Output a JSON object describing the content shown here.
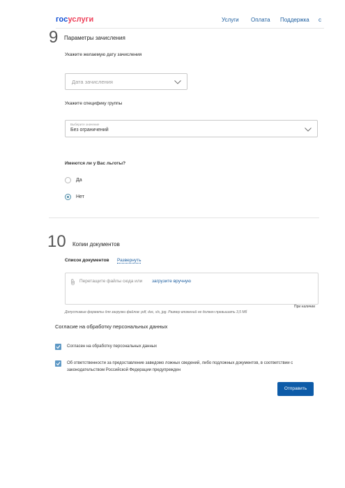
{
  "header": {
    "logo_part1": "гос",
    "logo_part2": "услуги",
    "nav": [
      "Услуги",
      "Оплата",
      "Поддержка"
    ],
    "nav_extra": "с"
  },
  "section9": {
    "number": "9",
    "title": "Параметры зачисления",
    "date_label": "Укажите желаемую дату зачисления",
    "date_placeholder": "Дата зачисления",
    "group_label": "Укажите специфику группы",
    "group_select_caption": "Выберите значение",
    "group_select_value": "Без ограничений",
    "benefits_question": "Имеются ли у Вас льготы?",
    "benefits_options": [
      "Да",
      "Нет"
    ],
    "benefits_selected": "Нет"
  },
  "section10": {
    "number": "10",
    "title": "Копии документов",
    "doc_list_label": "Список документов",
    "expand_link": "Развернуть",
    "dropzone_text": "Перетащите файлы сюда или",
    "dropzone_link": "загрузите вручную",
    "side_note": "При наличии",
    "formats_note": "Допустимые форматы для загрузки файлов: pdf, doc, xls, jpg. Размер вложений не должен превышать 3,5 Мб"
  },
  "consent": {
    "title": "Согласие на обработку персональных данных",
    "items": [
      "Согласен на обработку персональных данных",
      "Об ответственности за предоставление заведомо ложных сведений, либо подложных документов, в соответствии с законодательством Российской Федерации предупрежден"
    ],
    "submit_label": "Отправить"
  },
  "colors": {
    "accent": "#0d5ba8",
    "link": "#1a5c9e",
    "checkbox": "#5d98c5"
  }
}
